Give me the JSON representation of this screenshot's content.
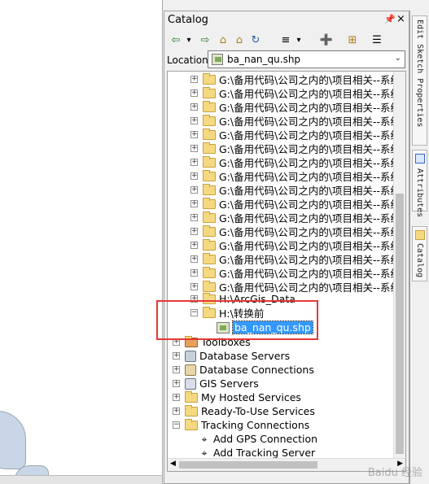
{
  "panel": {
    "title": "Catalog",
    "pin_glyph": "ₓ",
    "close_glyph": "×"
  },
  "toolbar": {
    "back_icon": "⇦",
    "back_dropdown": "▾",
    "forward_icon": "⇨",
    "up_icon": "⌂",
    "home_icon": "⌂",
    "refresh_icon": "↻",
    "view_icon": "≡",
    "view_dropdown": "▾",
    "connect_icon": "➕",
    "tree_icon": "⊞",
    "options_icon": "☰"
  },
  "location": {
    "label": "Location:",
    "value": "ba_nan_qu.shp"
  },
  "tree": {
    "folder_rows": [
      "G:\\备用代码\\公司之内的\\项目相关--系统",
      "G:\\备用代码\\公司之内的\\项目相关--系统",
      "G:\\备用代码\\公司之内的\\项目相关--系统",
      "G:\\备用代码\\公司之内的\\项目相关--系统",
      "G:\\备用代码\\公司之内的\\项目相关--系统",
      "G:\\备用代码\\公司之内的\\项目相关--系统",
      "G:\\备用代码\\公司之内的\\项目相关--系统",
      "G:\\备用代码\\公司之内的\\项目相关--系统",
      "G:\\备用代码\\公司之内的\\项目相关--系统",
      "G:\\备用代码\\公司之内的\\项目相关--系统",
      "G:\\备用代码\\公司之内的\\项目相关--系统",
      "G:\\备用代码\\公司之内的\\项目相关--系统",
      "G:\\备用代码\\公司之内的\\项目相关--系统",
      "G:\\备用代码\\公司之内的\\项目相关--系统",
      "G:\\备用代码\\公司之内的\\项目相关--系统",
      "G:\\备用代码\\公司之内的\\项目相关--系统"
    ],
    "arcgis_data": "H:\\ArcGis_Data",
    "convert_folder": "H:\\转换前",
    "shp_file": "ba_nan_qu.shp",
    "toolboxes": "Toolboxes",
    "database_servers": "Database Servers",
    "database_connections": "Database Connections",
    "gis_servers": "GIS Servers",
    "my_hosted_services": "My Hosted Services",
    "ready_to_use": "Ready-To-Use Services",
    "tracking_connections": "Tracking Connections",
    "add_gps": "Add GPS Connection",
    "add_tracking_server": "Add Tracking Server"
  },
  "sidetabs": {
    "edit_sketch": "Edit Sketch Properties",
    "attributes": "Attributes",
    "catalog": "Catalog"
  },
  "watermark": "Baidu 经验"
}
